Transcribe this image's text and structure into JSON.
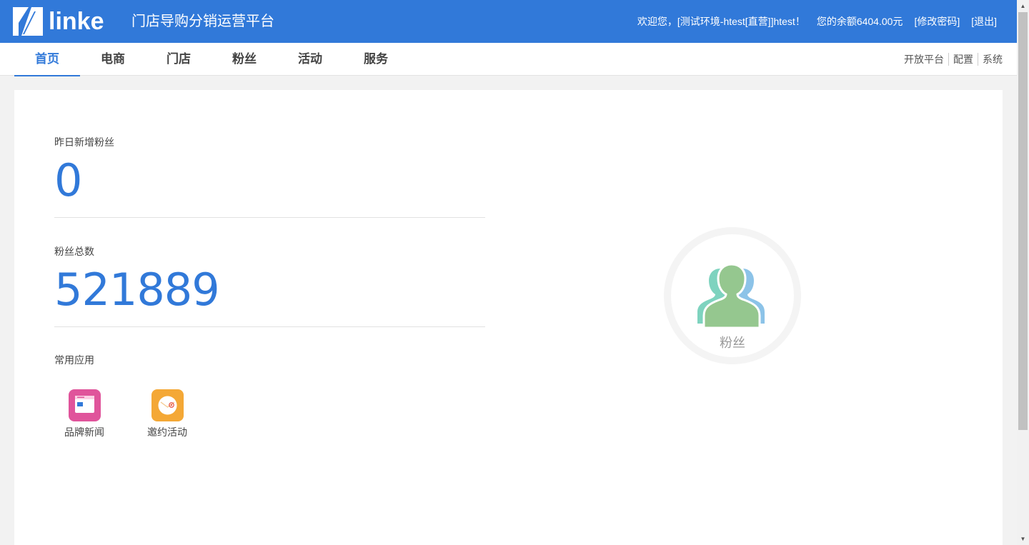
{
  "header": {
    "logo_text": "linke",
    "platform_title": "门店导购分销运营平台",
    "welcome": "欢迎您，[测试环境-htest[直营]]htest！",
    "balance": "您的余额6404.00元",
    "change_password": "[修改密码]",
    "logout": "[退出]",
    "bg_color": "#3179d9"
  },
  "nav": {
    "tabs": [
      {
        "label": "首页",
        "active": true
      },
      {
        "label": "电商"
      },
      {
        "label": "门店"
      },
      {
        "label": "粉丝"
      },
      {
        "label": "活动"
      },
      {
        "label": "服务"
      }
    ],
    "right": [
      "开放平台",
      "配置",
      "系统"
    ]
  },
  "main": {
    "yesterday_new_fans": {
      "label": "昨日新增粉丝",
      "value": "0"
    },
    "total_fans": {
      "label": "粉丝总数",
      "value": "521889"
    },
    "apps_label": "常用应用",
    "apps": [
      {
        "label": "品牌新闻",
        "icon": "news-icon",
        "color": "#e0549b"
      },
      {
        "label": "邀约活动",
        "icon": "invite-icon",
        "color": "#f4a836"
      }
    ],
    "fans_widget": {
      "label": "粉丝",
      "icon": "fans-group-icon"
    }
  },
  "scrollbar": {
    "up": "▲",
    "down": "▼"
  }
}
